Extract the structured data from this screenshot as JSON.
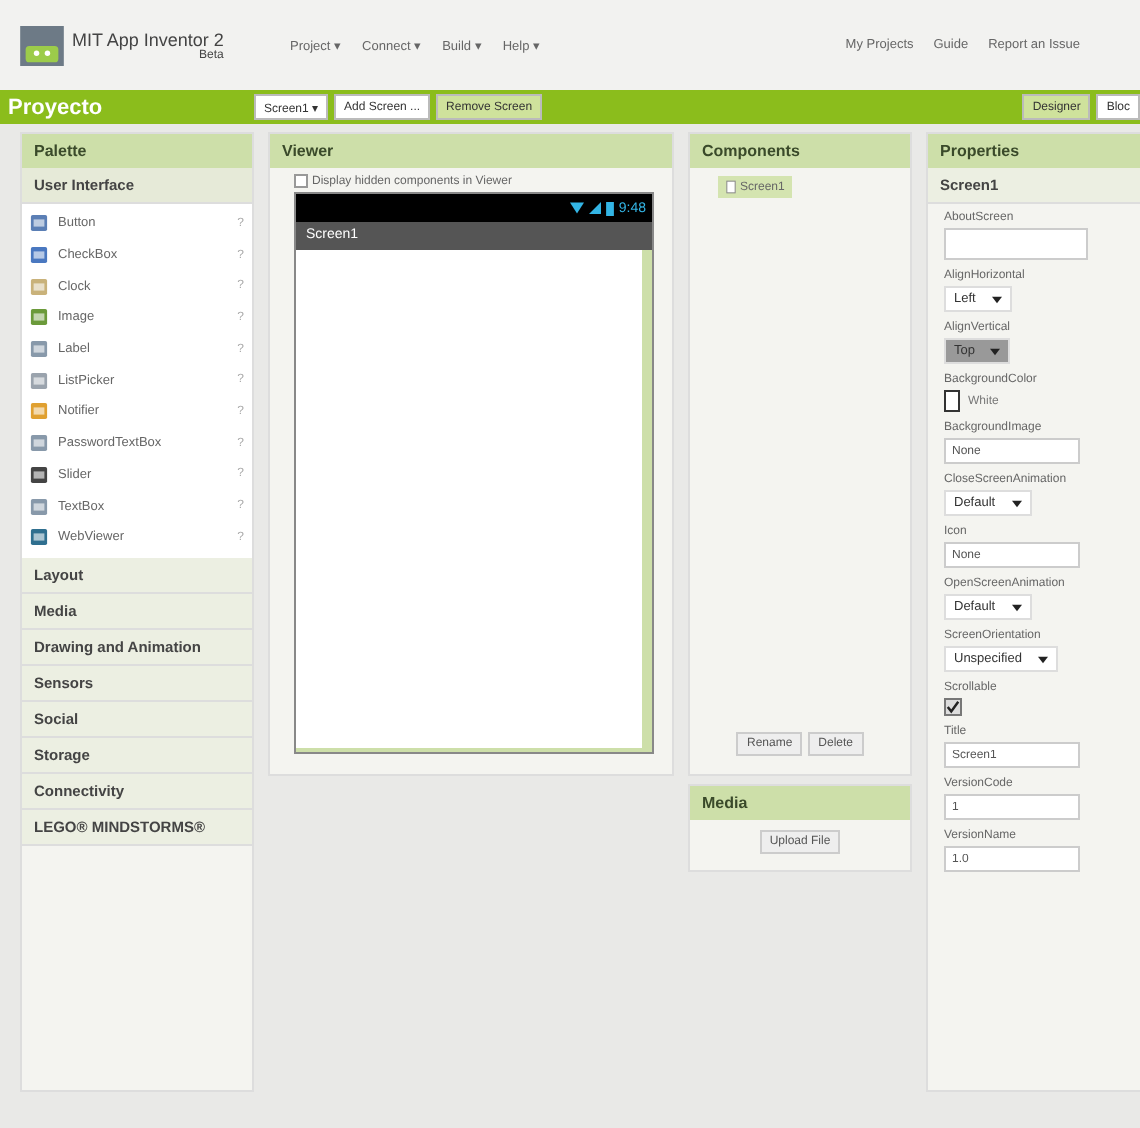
{
  "header": {
    "app_name": "MIT App Inventor 2",
    "app_tag": "Beta",
    "menus": [
      "Project ▾",
      "Connect ▾",
      "Build ▾",
      "Help ▾"
    ],
    "links": [
      "My Projects",
      "Guide",
      "Report an Issue"
    ]
  },
  "toolbar": {
    "project": "Proyecto",
    "buttons": [
      {
        "label": "Screen1 ▾",
        "kind": "button"
      },
      {
        "label": "Add Screen ...",
        "kind": "button"
      },
      {
        "label": "Remove Screen",
        "kind": "muted"
      }
    ],
    "views": [
      {
        "label": "Designer",
        "selected": true
      },
      {
        "label": "Bloc",
        "selected": false
      }
    ]
  },
  "palette": {
    "title": "Palette",
    "open_category": "User Interface",
    "items": [
      "Button",
      "CheckBox",
      "Clock",
      "Image",
      "Label",
      "ListPicker",
      "Notifier",
      "PasswordTextBox",
      "Slider",
      "TextBox",
      "WebViewer"
    ],
    "help": "?",
    "categories": [
      "Layout",
      "Media",
      "Drawing and Animation",
      "Sensors",
      "Social",
      "Storage",
      "Connectivity",
      "LEGO® MINDSTORMS®"
    ]
  },
  "viewer": {
    "title": "Viewer",
    "hidden_option": {
      "label": "Display hidden components in Viewer",
      "checked": false
    },
    "phone": {
      "time": "9:48",
      "screen_title": "Screen1"
    }
  },
  "components": {
    "title": "Components",
    "tree": [
      {
        "label": "Screen1",
        "selected": true
      }
    ],
    "buttons": [
      "Rename",
      "Delete"
    ]
  },
  "media": {
    "title": "Media",
    "button": "Upload File"
  },
  "properties": {
    "title": "Properties",
    "component": "Screen1",
    "items": [
      {
        "label": "AboutScreen",
        "kind": "textarea"
      },
      {
        "label": "AlignHorizontal",
        "kind": "dropdown",
        "value": "Left",
        "disabled": false
      },
      {
        "label": "AlignVertical",
        "kind": "dropdown",
        "value": "Top",
        "disabled": true
      },
      {
        "label": "BackgroundColor",
        "kind": "color",
        "value": "White",
        "color": "#ffffff"
      },
      {
        "label": "BackgroundImage",
        "kind": "field",
        "value": "None"
      },
      {
        "label": "CloseScreenAnimation",
        "kind": "dropdown",
        "value": "Default",
        "disabled": false
      },
      {
        "label": "Icon",
        "kind": "field",
        "value": "None"
      },
      {
        "label": "OpenScreenAnimation",
        "kind": "dropdown",
        "value": "Default",
        "disabled": false
      },
      {
        "label": "ScreenOrientation",
        "kind": "dropdown",
        "value": "Unspecified",
        "disabled": false
      },
      {
        "label": "Scrollable",
        "kind": "checkbox",
        "checked": true
      },
      {
        "label": "Title",
        "kind": "field",
        "value": "Screen1"
      },
      {
        "label": "VersionCode",
        "kind": "field",
        "value": "1"
      },
      {
        "label": "VersionName",
        "kind": "field",
        "value": "1.0"
      }
    ]
  }
}
